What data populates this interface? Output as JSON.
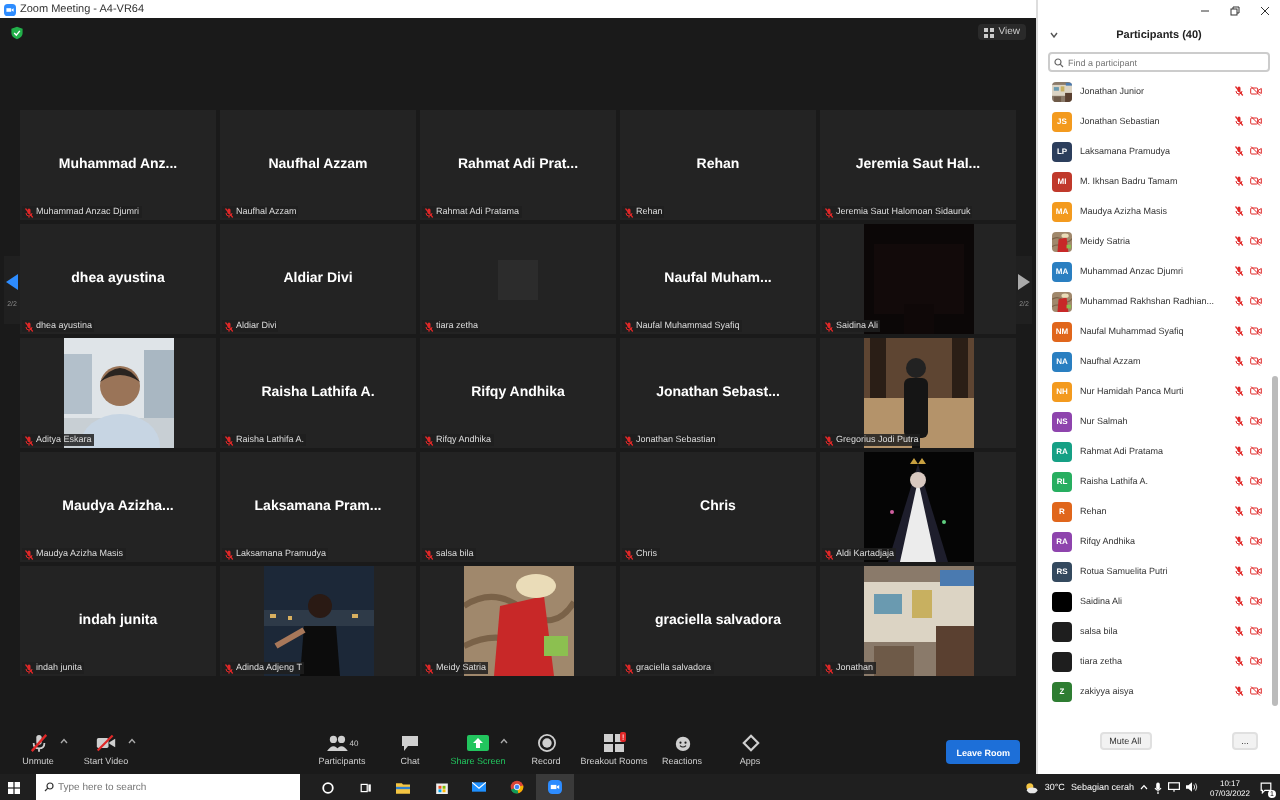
{
  "window": {
    "title": "Zoom Meeting - A4-VR64"
  },
  "meeting": {
    "view_label": "View",
    "page_prev": "2/2",
    "page_next": "2/2",
    "tiles": [
      {
        "kind": "name",
        "name": "Muhammad Anz...",
        "label": "Muhammad Anzac Djumri",
        "muted": true
      },
      {
        "kind": "name",
        "name": "Naufhal Azzam",
        "label": "Naufhal Azzam",
        "muted": true
      },
      {
        "kind": "name",
        "name": "Rahmat Adi Prat...",
        "label": "Rahmat Adi Pratama",
        "muted": true
      },
      {
        "kind": "name",
        "name": "Rehan",
        "label": "Rehan",
        "muted": true
      },
      {
        "kind": "name",
        "name": "Jeremia Saut Hal...",
        "label": "Jeremia Saut Halomoan Sidauruk",
        "muted": true
      },
      {
        "kind": "name",
        "name": "dhea ayustina",
        "label": "dhea ayustina",
        "muted": true
      },
      {
        "kind": "name",
        "name": "Aldiar Divi",
        "label": "Aldiar Divi",
        "muted": true
      },
      {
        "kind": "blank",
        "label": "tiara zetha",
        "muted": true
      },
      {
        "kind": "name",
        "name": "Naufal Muham...",
        "label": "Naufal Muhammad Syafiq",
        "muted": true
      },
      {
        "kind": "dark",
        "label": "Saidina Ali",
        "muted": true
      },
      {
        "kind": "video",
        "label": "Aditya Eskara",
        "muted": true
      },
      {
        "kind": "name",
        "name": "Raisha Lathifa A.",
        "label": "Raisha Lathifa A.",
        "muted": true
      },
      {
        "kind": "name",
        "name": "Rifqy Andhika",
        "label": "Rifqy Andhika",
        "muted": true
      },
      {
        "kind": "name",
        "name": "Jonathan Sebast...",
        "label": "Jonathan Sebastian",
        "muted": true
      },
      {
        "kind": "video",
        "label": "Gregorius Jodi Putra",
        "muted": true
      },
      {
        "kind": "name",
        "name": "Maudya Azizha...",
        "label": "Maudya Azizha Masis",
        "muted": true
      },
      {
        "kind": "name",
        "name": "Laksamana Pram...",
        "label": "Laksamana Pramudya",
        "muted": true
      },
      {
        "kind": "empty",
        "label": "salsa bila",
        "muted": true
      },
      {
        "kind": "name",
        "name": "Chris",
        "label": "Chris",
        "muted": true
      },
      {
        "kind": "video",
        "label": "Aldi Kartadjaja",
        "muted": true
      },
      {
        "kind": "name",
        "name": "indah junita",
        "label": "indah junita",
        "muted": true
      },
      {
        "kind": "video",
        "label": "Adinda Adjeng T",
        "muted": true
      },
      {
        "kind": "video",
        "label": "Meidy Satria",
        "muted": true
      },
      {
        "kind": "name",
        "name": "graciella salvadora",
        "label": "graciella salvadora",
        "muted": true
      },
      {
        "kind": "video",
        "label": "Jonathan",
        "muted": true
      }
    ]
  },
  "toolbar": {
    "left": [
      {
        "kind": "audio",
        "label": "Unmute",
        "has_menu": true
      },
      {
        "kind": "video",
        "label": "Start Video",
        "has_menu": true
      }
    ],
    "center": [
      {
        "kind": "participants",
        "label": "Participants",
        "count": "40",
        "has_menu": false
      },
      {
        "kind": "chat",
        "label": "Chat",
        "has_menu": false
      },
      {
        "kind": "share",
        "label": "Share Screen",
        "has_menu": true
      },
      {
        "kind": "record",
        "label": "Record",
        "has_menu": false
      },
      {
        "kind": "breakout",
        "label": "Breakout Rooms",
        "badge": "!",
        "has_menu": false
      },
      {
        "kind": "reactions",
        "label": "Reactions",
        "has_menu": false
      },
      {
        "kind": "apps",
        "label": "Apps",
        "has_menu": false
      }
    ],
    "leave_button": "Leave Room"
  },
  "participants_panel": {
    "title": "Participants (40)",
    "search": {
      "placeholder": "Find a participant"
    },
    "participants": [
      {
        "name": "Jonathan Junior",
        "muted": true,
        "video_off": true
      },
      {
        "name": "Jonathan Sebastian",
        "kind": "initials",
        "initials": "JS",
        "color": "#f39a1e",
        "muted": true,
        "video_off": true
      },
      {
        "name": "Laksamana Pramudya",
        "kind": "initials",
        "initials": "LP",
        "color": "#2c3e5c",
        "muted": true,
        "video_off": true
      },
      {
        "name": "M. Ikhsan Badru Tamam",
        "kind": "initials",
        "initials": "MI",
        "color": "#c0392b",
        "muted": true,
        "video_off": true
      },
      {
        "name": "Maudya Azizha Masis",
        "kind": "initials",
        "initials": "MA",
        "color": "#f39a1e",
        "muted": true,
        "video_off": true
      },
      {
        "name": "Meidy Satria",
        "muted": true,
        "video_off": true
      },
      {
        "name": "Muhammad Anzac Djumri",
        "kind": "initials",
        "initials": "MA",
        "color": "#2a7fc1",
        "muted": true,
        "video_off": true
      },
      {
        "name": "Muhammad Rakhshan Radhian...",
        "muted": true,
        "video_off": true
      },
      {
        "name": "Naufal Muhammad Syafiq",
        "kind": "initials",
        "initials": "NM",
        "color": "#e0661c",
        "muted": true,
        "video_off": true
      },
      {
        "name": "Naufhal Azzam",
        "kind": "initials",
        "initials": "NA",
        "color": "#2a7fc1",
        "muted": true,
        "video_off": true
      },
      {
        "name": "Nur Hamidah Panca Murti",
        "kind": "initials",
        "initials": "NH",
        "color": "#f39a1e",
        "muted": true,
        "video_off": true
      },
      {
        "name": "Nur Salmah",
        "kind": "initials",
        "initials": "NS",
        "color": "#8e44ad",
        "muted": true,
        "video_off": true
      },
      {
        "name": "Rahmat Adi Pratama",
        "kind": "initials",
        "initials": "RA",
        "color": "#16a085",
        "muted": true,
        "video_off": true
      },
      {
        "name": "Raisha Lathifa A.",
        "kind": "initials",
        "initials": "RL",
        "color": "#27ae60",
        "muted": true,
        "video_off": true
      },
      {
        "name": "Rehan",
        "kind": "initials",
        "initials": "R",
        "color": "#e0661c",
        "muted": true,
        "video_off": true
      },
      {
        "name": "Rifqy Andhika",
        "kind": "initials",
        "initials": "RA",
        "color": "#8e44ad",
        "muted": true,
        "video_off": true
      },
      {
        "name": "Rotua Samuelita Putri",
        "kind": "initials",
        "initials": "RS",
        "color": "#34495e",
        "muted": true,
        "video_off": true
      },
      {
        "name": "Saidina Ali",
        "kind": "blank",
        "color": "#000000",
        "muted": true,
        "video_off": true
      },
      {
        "name": "salsa bila",
        "kind": "blank",
        "color": "#1e1e1e",
        "muted": true,
        "video_off": true
      },
      {
        "name": "tiara zetha",
        "kind": "blank",
        "color": "#1e1e1e",
        "muted": true,
        "video_off": true
      },
      {
        "name": "zakiyya aisya",
        "kind": "initials",
        "initials": "Z",
        "color": "#2e7d32",
        "muted": true,
        "video_off": true
      }
    ],
    "mute_all_button": "Mute All",
    "more_button": "..."
  },
  "taskbar": {
    "search": {
      "placeholder": "Type here to search"
    },
    "temperature": "30°C",
    "weather": "Sebagian cerah",
    "time": "10:17",
    "date": "07/03/2022",
    "notification_count": "1"
  }
}
